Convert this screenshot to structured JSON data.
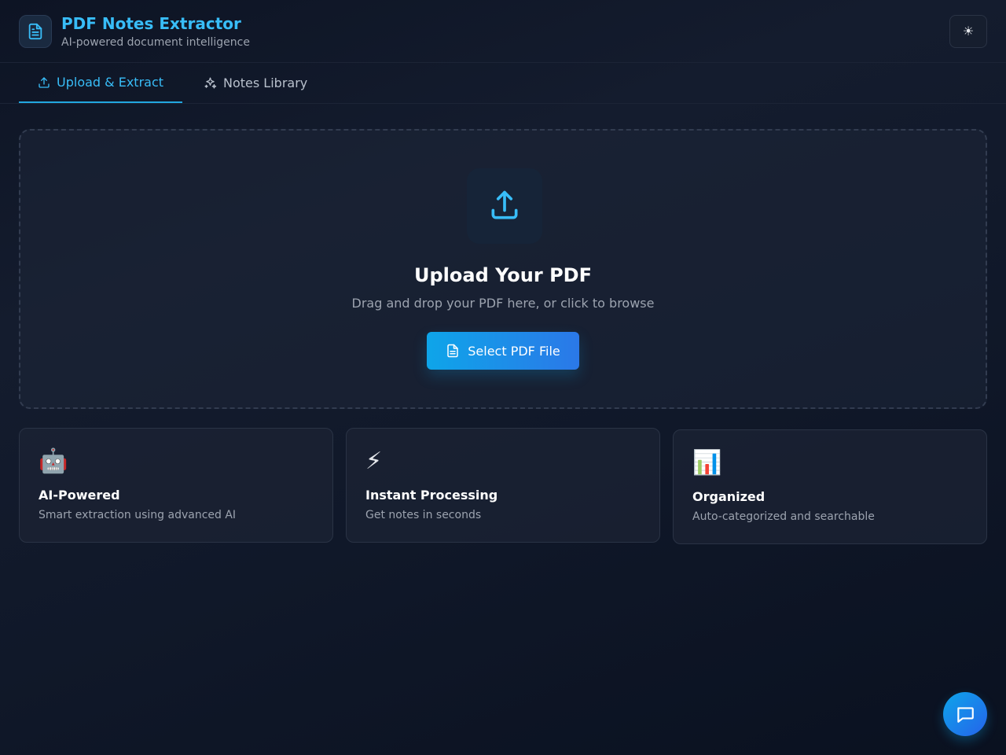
{
  "header": {
    "title": "PDF Notes Extractor",
    "subtitle": "AI-powered document intelligence",
    "logo_icon": "document-icon",
    "theme_toggle_icon": "sun-icon",
    "theme_toggle_glyph": "☀"
  },
  "tabs": [
    {
      "label": "Upload & Extract",
      "icon": "upload-icon",
      "active": true
    },
    {
      "label": "Notes Library",
      "icon": "sparkles-icon",
      "active": false
    }
  ],
  "upload": {
    "icon": "upload-icon",
    "title": "Upload Your PDF",
    "hint": "Drag and drop your PDF here, or click to browse",
    "button_label": "Select PDF File",
    "button_icon": "file-icon"
  },
  "features": [
    {
      "emoji": "🤖",
      "icon": "robot-icon",
      "title": "AI-Powered",
      "description": "Smart extraction using advanced AI"
    },
    {
      "emoji": "⚡",
      "icon": "lightning-icon",
      "title": "Instant Processing",
      "description": "Get notes in seconds"
    },
    {
      "emoji": "📊",
      "icon": "bar-chart-icon",
      "title": "Organized",
      "description": "Auto-categorized and searchable"
    }
  ],
  "chat": {
    "icon": "chat-bubble-icon"
  },
  "colors": {
    "accent": "#38bdf8",
    "button_gradient_start": "#0ea5e9",
    "button_gradient_end": "#2b78e8",
    "background": "#111827"
  }
}
